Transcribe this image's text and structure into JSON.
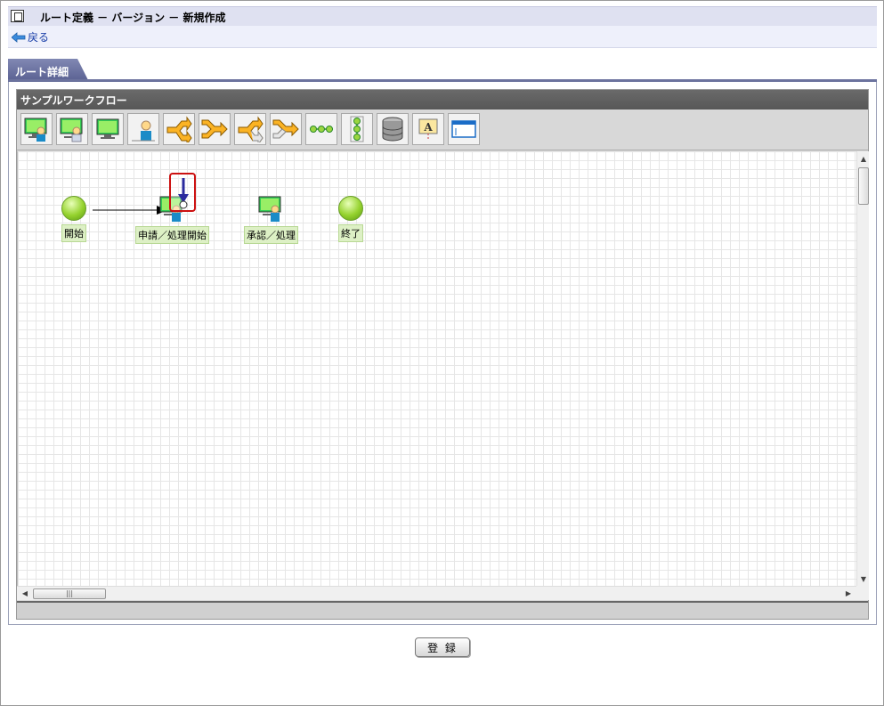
{
  "page": {
    "title": "ルート定義 － バージョン － 新規作成",
    "back_label": "戻る"
  },
  "tab": {
    "label": "ルート詳細"
  },
  "editor": {
    "name": "サンプルワークフロー",
    "toolbar_icons": [
      "user-task-icon",
      "user-task-alt-icon",
      "monitor-task-icon",
      "person-icon",
      "branch-split-icon",
      "branch-merge-icon",
      "branch-split-gray-icon",
      "branch-merge-gray-icon",
      "horizontal-chain-icon",
      "vertical-chain-icon",
      "database-icon",
      "text-label-icon",
      "window-icon"
    ]
  },
  "nodes": {
    "start": {
      "label": "開始"
    },
    "apply": {
      "label": "申請／処理開始"
    },
    "approve": {
      "label": "承認／処理"
    },
    "end": {
      "label": "終了"
    }
  },
  "colors": {
    "accent": "#6c739e",
    "highlight": "#cc1111",
    "node_green": "#95d22e"
  },
  "footer": {
    "register_label": "登 録"
  }
}
